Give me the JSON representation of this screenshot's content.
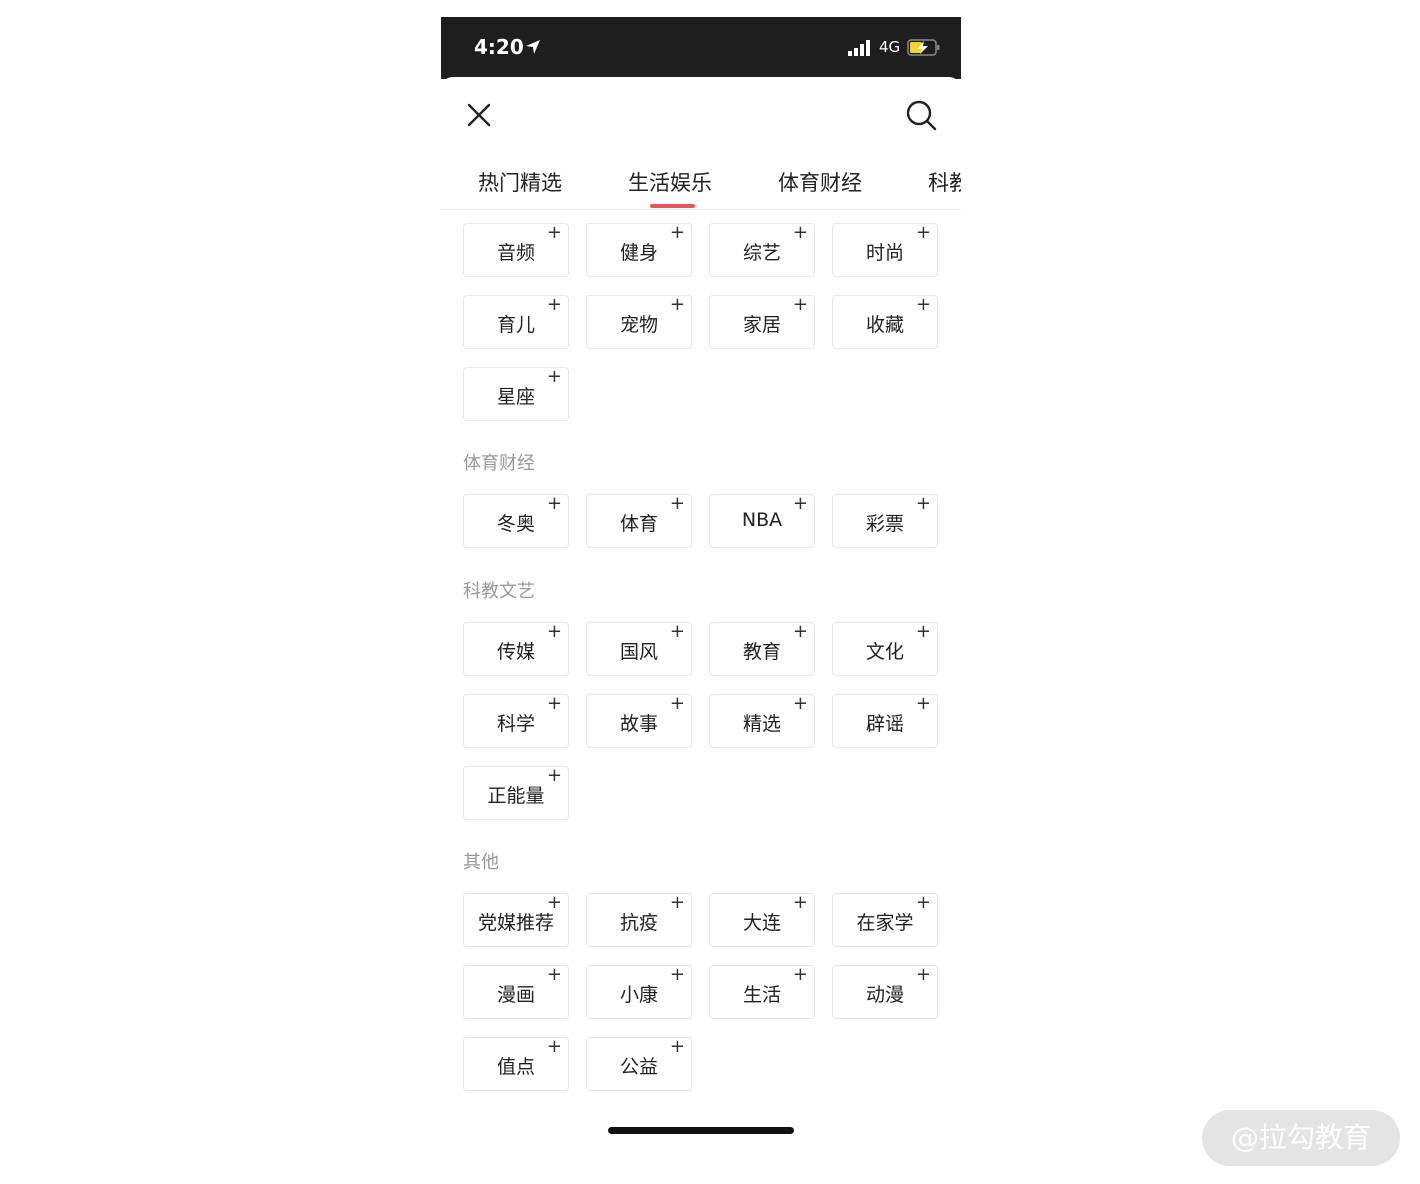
{
  "status_bar": {
    "time": "4:20",
    "network": "4G",
    "icons": [
      "location-arrow-icon",
      "signal-bars-icon",
      "battery-charging-icon"
    ]
  },
  "header": {
    "close_icon": "close-icon",
    "search_icon": "search-icon"
  },
  "tabs": [
    {
      "label": "热门精选",
      "active": false
    },
    {
      "label": "生活娱乐",
      "active": true
    },
    {
      "label": "体育财经",
      "active": false
    },
    {
      "label": "科教",
      "active": false
    }
  ],
  "accent_color": "#e8555e",
  "sections": [
    {
      "title": "",
      "items": [
        "音频",
        "健身",
        "综艺",
        "时尚",
        "育儿",
        "宠物",
        "家居",
        "收藏",
        "星座"
      ]
    },
    {
      "title": "体育财经",
      "items": [
        "冬奥",
        "体育",
        "NBA",
        "彩票"
      ]
    },
    {
      "title": "科教文艺",
      "items": [
        "传媒",
        "国风",
        "教育",
        "文化",
        "科学",
        "故事",
        "精选",
        "辟谣",
        "正能量"
      ]
    },
    {
      "title": "其他",
      "items": [
        "党媒推荐",
        "抗疫",
        "大连",
        "在家学",
        "漫画",
        "小康",
        "生活",
        "动漫",
        "值点",
        "公益"
      ]
    }
  ],
  "chip_add_symbol": "+",
  "watermark": "@拉勾教育"
}
